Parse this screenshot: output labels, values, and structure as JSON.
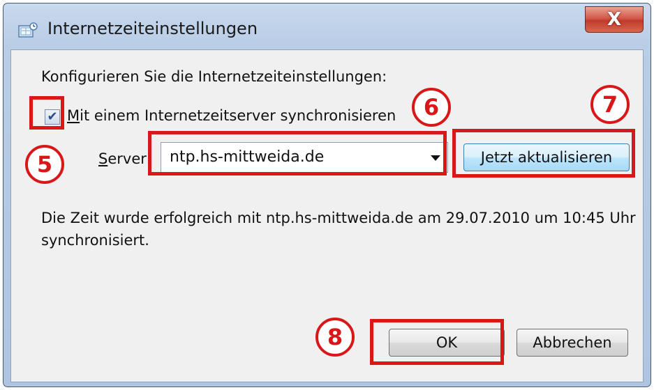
{
  "window": {
    "title": "Internetzeiteinstellungen",
    "close_label": "X"
  },
  "heading": "Konfigurieren Sie die Internetzeiteinstellungen:",
  "sync_checkbox": {
    "checked": true,
    "label_accel": "M",
    "label_rest": "it einem Internetzeitserver synchronisieren"
  },
  "server": {
    "label_accel": "S",
    "label_rest": "erver:",
    "value": "ntp.hs-mittweida.de"
  },
  "buttons": {
    "update_label": "Jetzt aktualisieren",
    "ok_label": "OK",
    "cancel_label": "Abbrechen"
  },
  "status_text": "Die Zeit wurde erfolgreich mit ntp.hs-mittweida.de am 29.07.2010 um 10:45 Uhr synchronisiert.",
  "annotations": {
    "badge_5": "5",
    "badge_6": "6",
    "badge_7": "7",
    "badge_8": "8",
    "color": "#d81818"
  }
}
